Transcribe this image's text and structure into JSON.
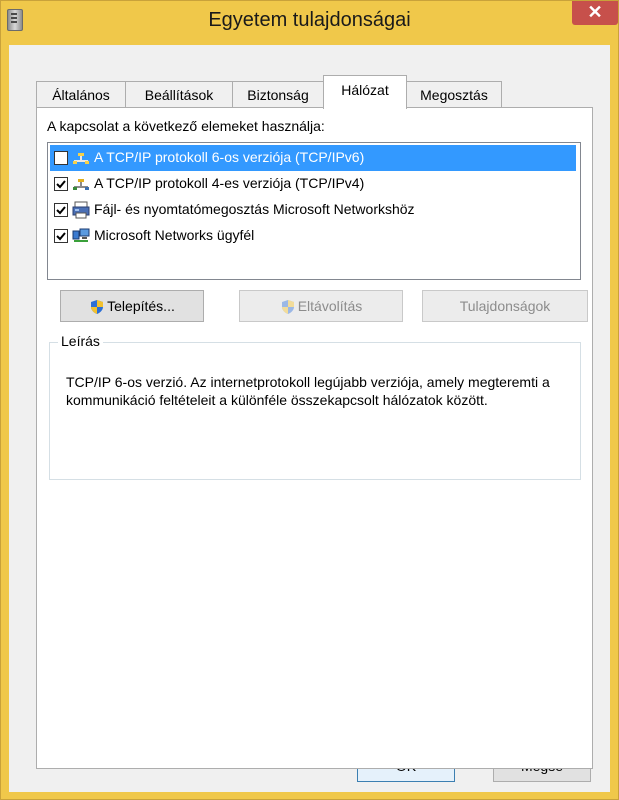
{
  "window": {
    "title": "Egyetem tulajdonságai",
    "close_symbol": "✕"
  },
  "tabs": [
    {
      "label": "Általános"
    },
    {
      "label": "Beállítások"
    },
    {
      "label": "Biztonság"
    },
    {
      "label": "Hálózat",
      "active": true
    },
    {
      "label": "Megosztás"
    }
  ],
  "network": {
    "connection_label": "A kapcsolat a következő elemeket használja:",
    "items": [
      {
        "label": "A TCP/IP protokoll 6-os verziója (TCP/IPv6)",
        "checked": false,
        "selected": true,
        "icon": "network-protocol-icon"
      },
      {
        "label": "A TCP/IP protokoll 4-es verziója (TCP/IPv4)",
        "checked": true,
        "selected": false,
        "icon": "network-protocol-icon"
      },
      {
        "label": "Fájl- és nyomtatómegosztás Microsoft Networkshöz",
        "checked": true,
        "selected": false,
        "icon": "file-printer-sharing-icon"
      },
      {
        "label": "Microsoft Networks ügyfél",
        "checked": true,
        "selected": false,
        "icon": "network-client-icon"
      }
    ],
    "buttons": {
      "install": "Telepítés...",
      "uninstall": "Eltávolítás",
      "properties": "Tulajdonságok"
    },
    "description": {
      "legend": "Leírás",
      "text": "TCP/IP 6-os verzió. Az internetprotokoll legújabb verziója, amely megteremti a kommunikáció feltételeit a különféle összekapcsolt hálózatok között."
    }
  },
  "footer": {
    "ok": "OK",
    "cancel": "Mégse"
  },
  "colors": {
    "frame": "#f0c84a",
    "close": "#c7504b",
    "selection": "#3399ff"
  }
}
